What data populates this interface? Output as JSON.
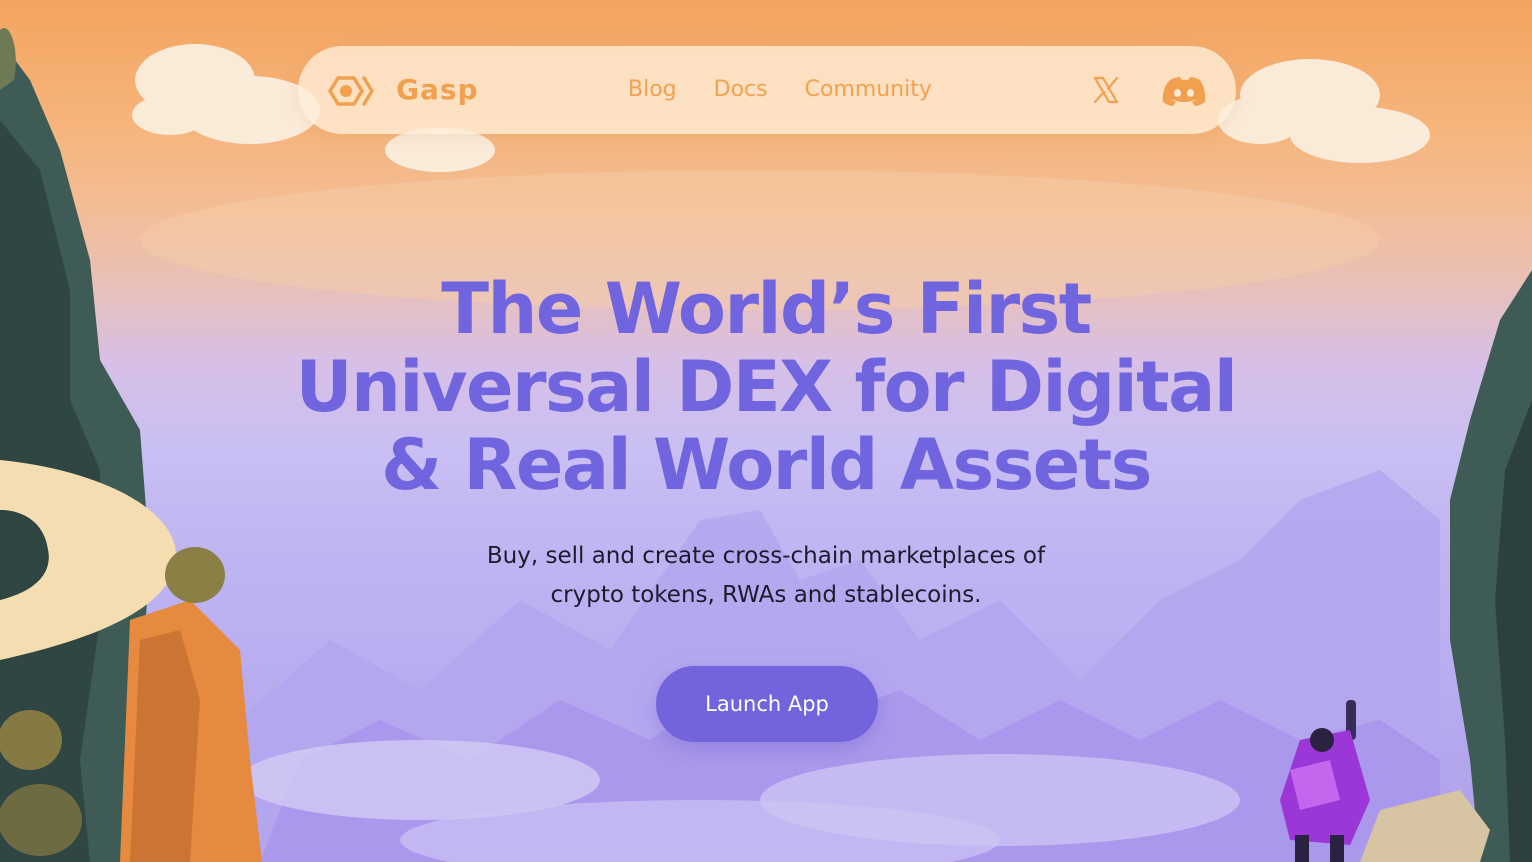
{
  "brand": {
    "name": "Gasp",
    "logo_icon": "gasp-logo-icon",
    "color": "#f1a04e"
  },
  "nav": {
    "links": [
      {
        "label": "Blog"
      },
      {
        "label": "Docs"
      },
      {
        "label": "Community"
      }
    ],
    "social": [
      {
        "icon": "x-twitter-icon"
      },
      {
        "icon": "discord-icon"
      }
    ]
  },
  "hero": {
    "headline": [
      "The World’s First",
      "Universal DEX for Digital",
      "& Real World Assets"
    ],
    "subheadline": [
      "Buy, sell and create cross-chain marketplaces of",
      "crypto tokens, RWAs and stablecoins."
    ],
    "cta_label": "Launch App"
  },
  "colors": {
    "accent": "#7363dd",
    "headline": "#7065de",
    "nav_text": "#f0a24f",
    "sky_top": "#f3a460",
    "sky_bottom": "#ae9feb"
  }
}
